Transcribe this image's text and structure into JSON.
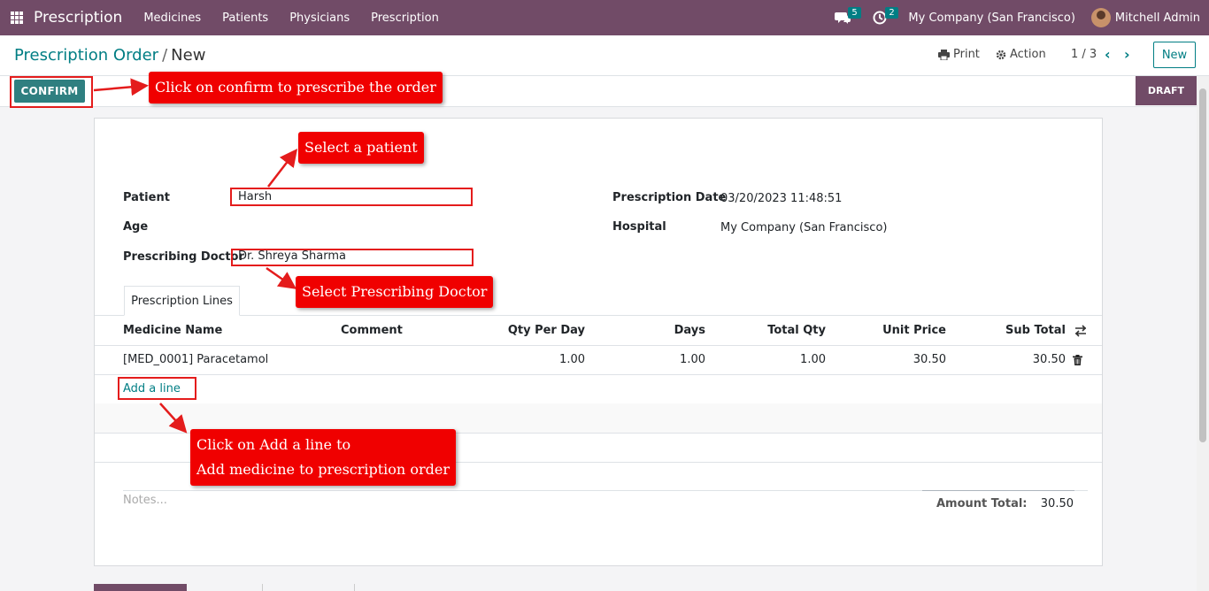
{
  "navbar": {
    "brand": "Prescription",
    "menu": [
      "Medicines",
      "Patients",
      "Physicians",
      "Prescription"
    ],
    "messages_count": "5",
    "activities_count": "2",
    "company": "My Company (San Francisco)",
    "user": "Mitchell Admin"
  },
  "control": {
    "breadcrumb_parent": "Prescription Order",
    "breadcrumb_separator": "/",
    "breadcrumb_current": "New",
    "print_label": "Print",
    "action_label": "Action",
    "pager": "1 / 3",
    "new_label": "New"
  },
  "statusbar": {
    "confirm_label": "CONFIRM",
    "state": "DRAFT"
  },
  "form": {
    "patient_label": "Patient",
    "patient_value": "Harsh",
    "age_label": "Age",
    "doctor_label": "Prescribing Doctor",
    "doctor_value": "Dr. Shreya Sharma",
    "date_label": "Prescription Date",
    "date_value": "03/20/2023 11:48:51",
    "hospital_label": "Hospital",
    "hospital_value": "My Company (San Francisco)"
  },
  "tabs": [
    "Prescription Lines"
  ],
  "table": {
    "headers": [
      "Medicine Name",
      "Comment",
      "Qty Per Day",
      "Days",
      "Total Qty",
      "Unit Price",
      "Sub Total"
    ],
    "rows": [
      {
        "medicine": "[MED_0001] Paracetamol",
        "comment": "",
        "qty_per_day": "1.00",
        "days": "1.00",
        "total_qty": "1.00",
        "unit_price": "30.50",
        "sub_total": "30.50"
      }
    ],
    "add_line": "Add a line"
  },
  "footer": {
    "notes_placeholder": "Notes...",
    "amount_total_label": "Amount Total:",
    "amount_total_value": "30.50"
  },
  "annotations": {
    "confirm": "Click on confirm to prescribe the order",
    "patient": "Select a patient",
    "doctor": "Select Prescribing Doctor",
    "add_line_1": "Click on Add a line to",
    "add_line_2": "Add medicine to prescription order"
  },
  "colors": {
    "navbar": "#714B67",
    "accent": "#017e84",
    "annotation": "#f00000"
  }
}
